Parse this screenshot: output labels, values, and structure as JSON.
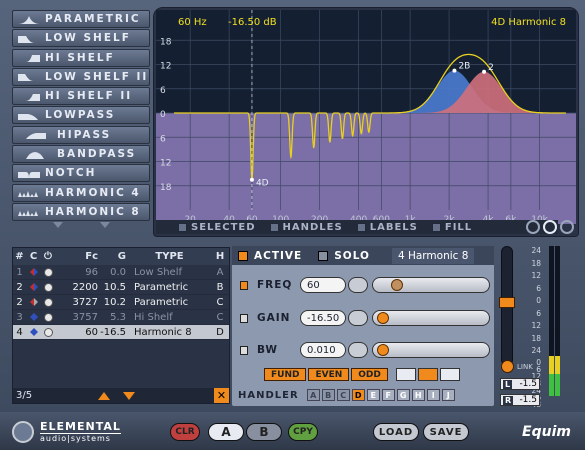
{
  "filter_types": [
    {
      "label": "PARAMETRIC",
      "icon": "parametric-icon"
    },
    {
      "label": "LOW SHELF",
      "icon": "low-shelf-icon"
    },
    {
      "label": "HI SHELF",
      "icon": "hi-shelf-icon"
    },
    {
      "label": "LOW SHELF II",
      "icon": "low-shelf-ii-icon"
    },
    {
      "label": "HI SHELF II",
      "icon": "hi-shelf-ii-icon"
    },
    {
      "label": "LOWPASS",
      "icon": "lowpass-icon"
    },
    {
      "label": "HIPASS",
      "icon": "hipass-icon"
    },
    {
      "label": "BANDPASS",
      "icon": "bandpass-icon"
    },
    {
      "label": "NOTCH",
      "icon": "notch-icon"
    },
    {
      "label": "HARMONIC 4",
      "icon": "harmonic-icon"
    },
    {
      "label": "HARMONIC 8",
      "icon": "harmonic-icon"
    }
  ],
  "graph": {
    "readout_freq": "60 Hz",
    "readout_gain": "-16.50 dB",
    "band_name": "4D Harmonic 8",
    "y_labels": [
      "18",
      "12",
      "6",
      "0",
      "6",
      "12",
      "18"
    ],
    "x_labels": [
      "20",
      "40",
      "60",
      "100",
      "200",
      "400",
      "600",
      "1k",
      "2k",
      "4k",
      "6k",
      "10k"
    ],
    "x_values": [
      20,
      40,
      60,
      100,
      200,
      400,
      600,
      1000,
      2000,
      4000,
      6000,
      10000
    ],
    "freq_range": [
      15,
      16000
    ],
    "gain_range": [
      -24,
      24
    ],
    "markers": [
      {
        "label": "4D"
      },
      {
        "label": "2B"
      },
      {
        "label": "2"
      }
    ],
    "colors": {
      "bg": "#142032",
      "boost": "#4466b0",
      "cut": "#7c6ea6",
      "band_b": "#4a7bd0",
      "band_2": "#d0707c",
      "curve": "#e8d020"
    },
    "options": [
      {
        "label": "SELECTED"
      },
      {
        "label": "HANDLES"
      },
      {
        "label": "LABELS"
      },
      {
        "label": "FILL"
      }
    ]
  },
  "table": {
    "headers": [
      "#",
      "C",
      "⏻",
      "Fc",
      "G",
      "TYPE",
      "H"
    ],
    "rows": [
      {
        "n": "1",
        "fc": "96",
        "g": "0.0",
        "type": "Low Shelf",
        "h": "A",
        "dim": true,
        "sel": false
      },
      {
        "n": "2",
        "fc": "2200",
        "g": "10.5",
        "type": "Parametric",
        "h": "B",
        "dim": false,
        "sel": false
      },
      {
        "n": "2",
        "fc": "3727",
        "g": "10.2",
        "type": "Parametric",
        "h": "C",
        "dim": false,
        "sel": false
      },
      {
        "n": "3",
        "fc": "3757",
        "g": "5.3",
        "type": "Hi Shelf",
        "h": "C",
        "dim": true,
        "sel": false
      },
      {
        "n": "4",
        "fc": "60",
        "g": "-16.5",
        "type": "Harmonic 8",
        "h": "D",
        "dim": false,
        "sel": true
      }
    ],
    "count": "3/5"
  },
  "editor": {
    "active_label": "ACTIVE",
    "solo_label": "SOLO",
    "band_label": "4 Harmonic 8",
    "freq_label": "FREQ",
    "freq_value": "60",
    "gain_label": "GAIN",
    "gain_value": "-16.50",
    "bw_label": "BW",
    "bw_value": "0.010",
    "fund": "FUND",
    "even": "EVEN",
    "odd": "ODD",
    "handler_label": "HANDLER",
    "handlers": [
      "A",
      "B",
      "C",
      "D",
      "E",
      "F",
      "G",
      "H",
      "I",
      "J"
    ]
  },
  "meter": {
    "scale": [
      "24",
      "18",
      "12",
      "6",
      "0",
      "6",
      "12",
      "18",
      "24",
      "0",
      "6",
      "12",
      "18",
      "24",
      "36",
      "48"
    ],
    "link_label": "LINK",
    "l_label": "L",
    "l_value": "-1.5",
    "r_label": "R",
    "r_value": "-1.5"
  },
  "bottom": {
    "brand_top": "ELEMENTAL",
    "brand_bottom": "audio|systems",
    "clr": "CLR",
    "a": "A",
    "b": "B",
    "cpy": "CPY",
    "load": "LOAD",
    "save": "SAVE",
    "product": "Equim"
  }
}
